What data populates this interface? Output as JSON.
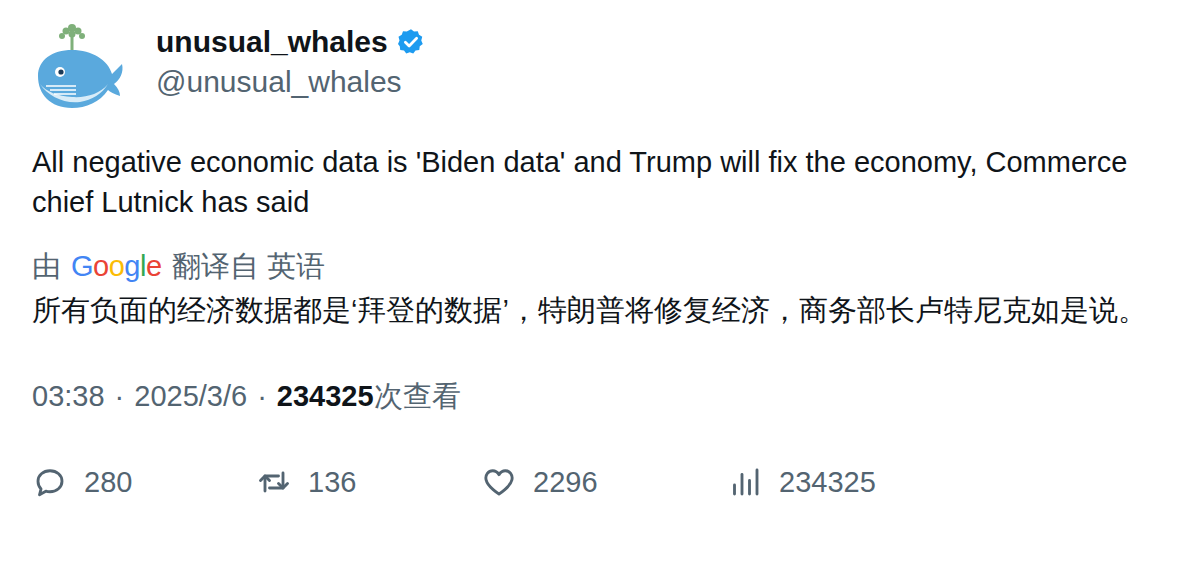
{
  "author": {
    "name": "unusual_whales",
    "verified": true,
    "handle": "@unusual_whales"
  },
  "text": "All negative economic data is 'Biden data' and Trump will fix the economy, Commerce chief Lutnick has said",
  "translation": {
    "prefix": "由",
    "brand": [
      {
        "letter": "G",
        "color": "#4285F4"
      },
      {
        "letter": "o",
        "color": "#EA4335"
      },
      {
        "letter": "o",
        "color": "#FBBC05"
      },
      {
        "letter": "g",
        "color": "#4285F4"
      },
      {
        "letter": "l",
        "color": "#34A853"
      },
      {
        "letter": "e",
        "color": "#EA4335"
      }
    ],
    "suffix": "翻译自 英语",
    "text": "所有负面的经济数据都是‘拜登的数据’，特朗普将修复经济，商务部长卢特尼克如是说。"
  },
  "meta": {
    "time": "03:38",
    "separator": "·",
    "date": "2025/3/6",
    "views": "234325",
    "views_label": "次查看"
  },
  "actions": [
    {
      "kind": "reply",
      "count": "280"
    },
    {
      "kind": "retweet",
      "count": "136"
    },
    {
      "kind": "like",
      "count": "2296"
    },
    {
      "kind": "views",
      "count": "234325"
    }
  ]
}
